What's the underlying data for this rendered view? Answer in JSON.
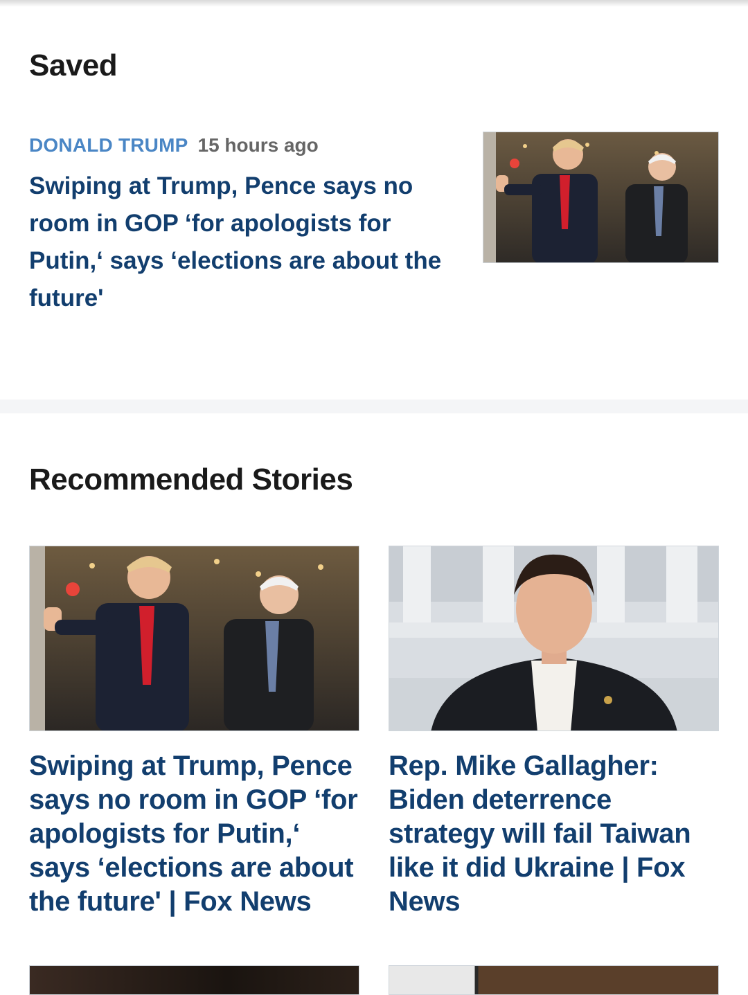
{
  "saved": {
    "title": "Saved",
    "item": {
      "category": "DONALD TRUMP",
      "time": "15 hours ago",
      "headline": "Swiping at Trump, Pence says no room in GOP ‘for apologists for Putin,‘ says ‘elections are about the future'"
    }
  },
  "recommended": {
    "title": "Recommended Stories",
    "items": [
      {
        "headline": "Swiping at Trump, Pence says no room in GOP ‘for apologists for Putin,‘ says ‘elections are about the future' | Fox News"
      },
      {
        "headline": "Rep. Mike Gallagher: Biden deterrence strategy will fail Taiwan like it did Ukraine | Fox News"
      }
    ]
  },
  "colors": {
    "headline": "#123e6e",
    "category": "#4a86c5",
    "meta": "#666666",
    "divider": "#f4f5f7"
  }
}
